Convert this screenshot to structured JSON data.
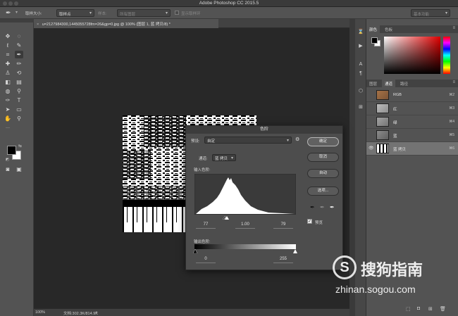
{
  "app": {
    "title": "Adobe Photoshop CC 2015.5"
  },
  "options_bar": {
    "sample_size_label": "取样大小:",
    "sample_size_value": "取样点",
    "sample_label": "样本:",
    "sample_value": "所有图层",
    "show_ring_label": "显示取样环",
    "workspace": "基本功能"
  },
  "document": {
    "tab_title": "u=2127984300,1445055728fm=26&gp=0.jpg @ 100% (图层 1, 蓝 拷贝/8) *",
    "zoom": "100%",
    "doc_size": "文档:302.3K/814.9K"
  },
  "color_panel": {
    "tabs": [
      "颜色",
      "色板"
    ],
    "active_tab": 0
  },
  "channels_panel": {
    "tabs": [
      "图层",
      "通道",
      "路径"
    ],
    "active_tab": 1,
    "channels": [
      {
        "name": "RGB",
        "shortcut": "⌘2",
        "visible": false,
        "selected": false
      },
      {
        "name": "红",
        "shortcut": "⌘3",
        "visible": false,
        "selected": false
      },
      {
        "name": "绿",
        "shortcut": "⌘4",
        "visible": false,
        "selected": false
      },
      {
        "name": "蓝",
        "shortcut": "⌘5",
        "visible": false,
        "selected": false
      },
      {
        "name": "蓝 拷贝",
        "shortcut": "⌘6",
        "visible": true,
        "selected": true
      }
    ]
  },
  "levels_dialog": {
    "title": "色阶",
    "preset_label": "预设:",
    "preset_value": "自定",
    "channel_label": "通道:",
    "channel_value": "蓝 拷贝",
    "input_label": "输入色阶:",
    "input_black": "77",
    "input_gamma": "1.00",
    "input_white": "79",
    "output_label": "输出色阶:",
    "output_black": "0",
    "output_white": "255",
    "buttons": {
      "ok": "确定",
      "cancel": "取消",
      "auto": "自动",
      "options": "选项..."
    },
    "preview_label": "预览",
    "preview_checked": true
  },
  "watermark": {
    "brand": "搜狗指南",
    "url": "zhinan.sogou.com"
  },
  "colors": {
    "panel_bg": "#535353",
    "canvas_bg": "#282828",
    "dialog_bg": "#4d4d4d",
    "selected_row": "#737373"
  }
}
